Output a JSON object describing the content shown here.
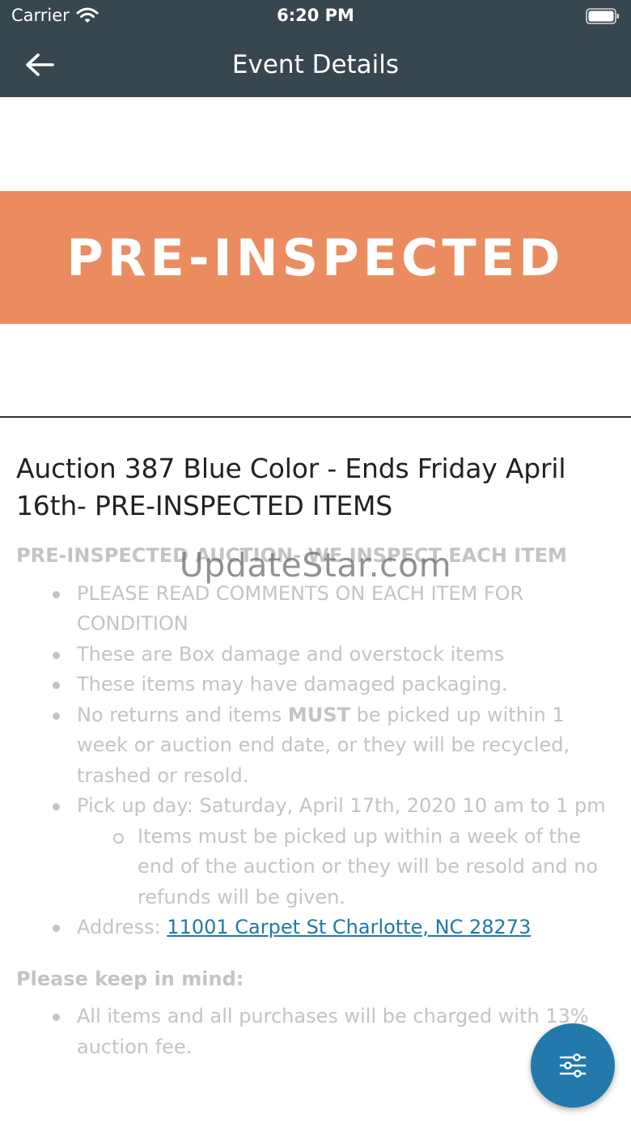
{
  "status": {
    "carrier": "Carrier",
    "time": "6:20 PM"
  },
  "nav": {
    "title": "Event Details",
    "back_icon": "arrow-left-icon"
  },
  "banner": {
    "text": "PRE-INSPECTED",
    "color": "#ea8c5f"
  },
  "event": {
    "title": "Auction 387 Blue Color - Ends Friday April 16th- PRE-INSPECTED ITEMS",
    "heading": "PRE-INSPECTED AUCTION- WE INSPECT EACH ITEM",
    "bullets": {
      "b1": "PLEASE READ COMMENTS ON EACH ITEM FOR CONDITION",
      "b2": "These are Box damage and overstock items",
      "b3": "These items may have damaged packaging.",
      "b4_pre": "No returns and items ",
      "b4_strong": "MUST",
      "b4_post": " be picked up within 1 week or auction end date, or they will be recycled, trashed or resold.",
      "b5": "Pick up day:  Saturday, April 17th, 2020 10 am to 1 pm",
      "b5_sub": "Items must be picked up within a week of the end of the auction or they will be resold and no refunds will be given.",
      "b6_label": "Address: ",
      "b6_link": "11001 Carpet St Charlotte, NC 28273"
    },
    "keep_in_mind": "Please keep in mind:",
    "keep_bullets": {
      "k1": "All items and all purchases will be charged with 13% auction fee."
    }
  },
  "watermark": "UpdateStar.com",
  "fab": {
    "icon": "filter-sliders-icon",
    "color": "#2379ac"
  },
  "colors": {
    "appbar": "#37474f",
    "link": "#2079a8"
  }
}
